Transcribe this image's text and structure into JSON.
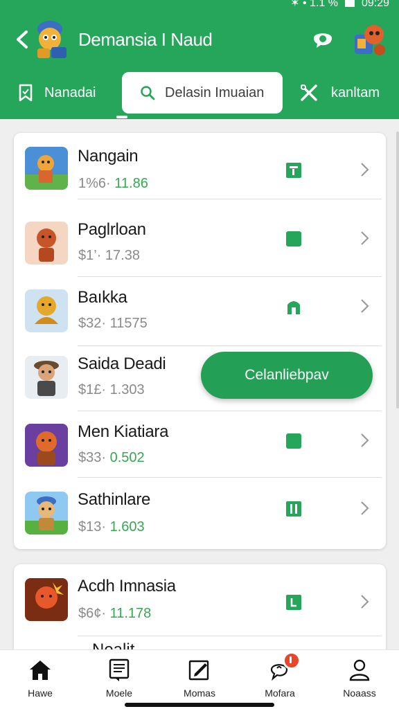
{
  "status_bar": {
    "signal": "✶ • 1.1 %",
    "time": "09:29"
  },
  "header": {
    "title": "Demansia I Naud"
  },
  "tabs": [
    {
      "label": "Nanadai",
      "icon": "bookmark-icon"
    },
    {
      "label": "Delasin Imuaian",
      "icon": "search-icon",
      "active": true
    },
    {
      "label": "kanltam",
      "icon": "tools-icon"
    }
  ],
  "items": [
    {
      "name": "Nangain",
      "price_a": "1%6·",
      "price_b": "11.86",
      "status_icon": "doc-icon"
    },
    {
      "name": "Paglrloan",
      "price_a": "$1’·",
      "price_b": "17.38",
      "status_icon": "square-icon"
    },
    {
      "name": "Baıkka",
      "price_a": "$32·",
      "price_b": "11575",
      "status_icon": "lock-icon"
    },
    {
      "name": "Saida Deadi",
      "price_a": "$1£·",
      "price_b": "1.303",
      "status_icon": ""
    },
    {
      "name": "Men Kiatiara",
      "price_a": "$33·",
      "price_b": "0.502",
      "status_icon": "square-icon"
    },
    {
      "name": "Sathinlare",
      "price_a": "$13·",
      "price_b": "1.603",
      "status_icon": "book-icon"
    }
  ],
  "item_next": {
    "name": "Acdh Imnasia",
    "price_a": "$6¢·",
    "price_b": "11.178",
    "status_icon": "l-icon"
  },
  "action_button": {
    "label": "Celanliebpav"
  },
  "cut_text": "Nealit",
  "nav": [
    {
      "label": "Hawe",
      "icon": "home-icon"
    },
    {
      "label": "Moele",
      "icon": "notes-icon"
    },
    {
      "label": "Momas",
      "icon": "edit-icon"
    },
    {
      "label": "Mofara",
      "icon": "chat-icon",
      "badge": true
    },
    {
      "label": "Noaass",
      "icon": "person-icon"
    }
  ],
  "colors": {
    "brand": "#26a65b",
    "price_green": "#34a853",
    "badge": "#e8462a"
  }
}
